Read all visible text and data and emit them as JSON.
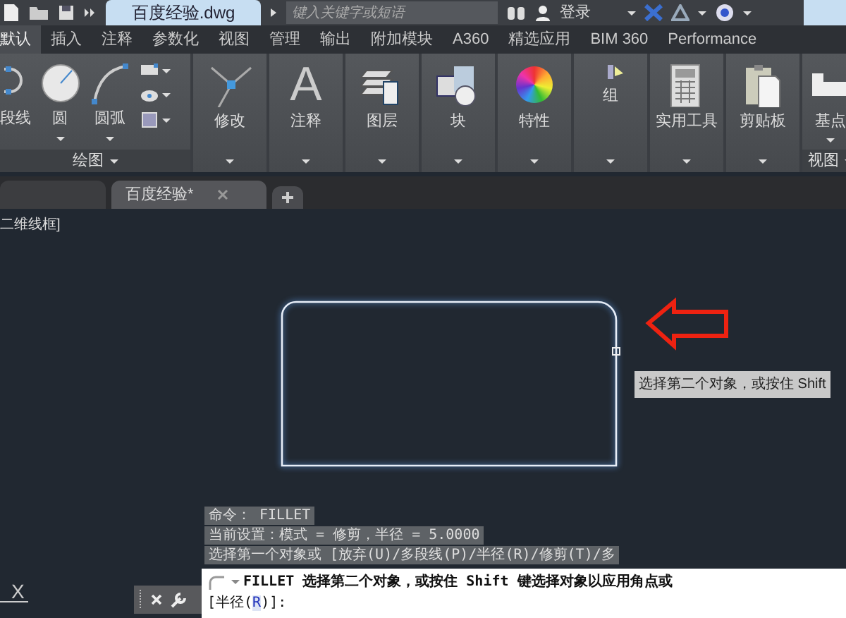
{
  "title_bar": {
    "file_tab": "百度经验.dwg",
    "search": {
      "placeholder": "键入关键字或短语"
    },
    "user": "登录"
  },
  "ribbon_tabs": [
    {
      "label": "默认",
      "selected": true
    },
    {
      "label": "插入",
      "selected": false
    },
    {
      "label": "注释",
      "selected": false
    },
    {
      "label": "参数化",
      "selected": false
    },
    {
      "label": "视图",
      "selected": false
    },
    {
      "label": "管理",
      "selected": false
    },
    {
      "label": "输出",
      "selected": false
    },
    {
      "label": "附加模块",
      "selected": false
    },
    {
      "label": "A360",
      "selected": false
    },
    {
      "label": "精选应用",
      "selected": false
    },
    {
      "label": "BIM 360",
      "selected": false
    },
    {
      "label": "Performance",
      "selected": false
    }
  ],
  "ribbon_panels": [
    {
      "kind": "draw",
      "title": "绘图",
      "tools": [
        {
          "label": "段线",
          "dropdown": false
        },
        {
          "label": "圆",
          "dropdown": true
        },
        {
          "label": "圆弧",
          "dropdown": true
        }
      ]
    },
    {
      "kind": "modify",
      "label": "修改"
    },
    {
      "kind": "annotate",
      "label": "注释",
      "glyph": "A"
    },
    {
      "kind": "layers",
      "label": "图层"
    },
    {
      "kind": "block",
      "label": "块"
    },
    {
      "kind": "properties",
      "label": "特性"
    },
    {
      "kind": "group",
      "label": "组"
    },
    {
      "kind": "utilities",
      "label": "实用工具"
    },
    {
      "kind": "clipboard",
      "label": "剪贴板"
    },
    {
      "kind": "view",
      "label": "基点",
      "title": "视图"
    }
  ],
  "document_tabs": [
    {
      "selected": false
    },
    {
      "label": "百度经验*",
      "selected": true
    }
  ],
  "viewport_label": "二维线框]",
  "tooltip": "选择第二个对象，或按住 Shift",
  "command_history": [
    "命令：  FILLET",
    "当前设置：模式 = 修剪，半径 = 5.0000",
    "选择第一个对象或 [放弃(U)/多段线(P)/半径(R)/修剪(T)/多"
  ],
  "command_line": {
    "prompt": "FILLET 选择第二个对象，或按住 Shift 键选择对象以应用角点或",
    "option_before": "[半径(",
    "option_key": "R",
    "option_after": ")]:"
  },
  "ucs_label": "X"
}
